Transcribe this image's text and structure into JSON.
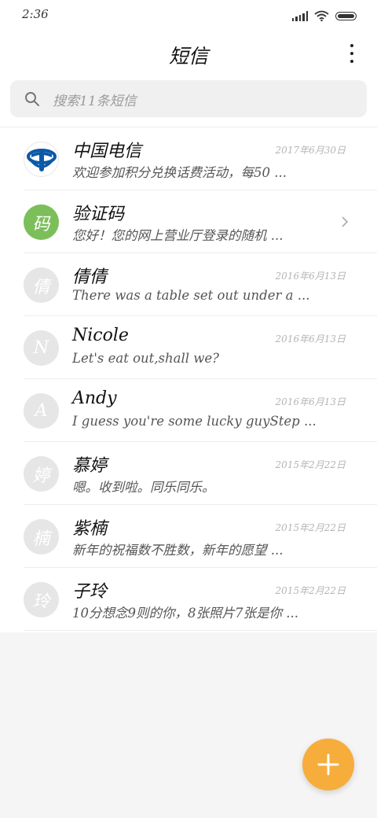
{
  "status_bar": {
    "time": "2:36"
  },
  "header": {
    "title": "短信"
  },
  "search": {
    "placeholder": "搜索11条短信"
  },
  "conversations": [
    {
      "name": "中国电信",
      "date": "2017年6月30日",
      "preview": "欢迎参加积分兑换话费活动，每50 ...",
      "avatar_text": "",
      "avatar_type": "logo",
      "has_chevron": false
    },
    {
      "name": "验证码",
      "date": "",
      "preview": "您好！您的网上营业厅登录的随机 ...",
      "avatar_text": "码",
      "avatar_type": "green",
      "has_chevron": true
    },
    {
      "name": "倩倩",
      "date": "2016年6月13日",
      "preview": "There was a table set out under a ...",
      "avatar_text": "倩",
      "avatar_type": "default",
      "has_chevron": false
    },
    {
      "name": "Nicole",
      "date": "2016年6月13日",
      "preview": "Let's eat out,shall we?",
      "avatar_text": "N",
      "avatar_type": "default",
      "has_chevron": false
    },
    {
      "name": "Andy",
      "date": "2016年6月13日",
      "preview": "I guess you're some lucky guyStep ...",
      "avatar_text": "A",
      "avatar_type": "default",
      "has_chevron": false
    },
    {
      "name": "慕婷",
      "date": "2015年2月22日",
      "preview": "嗯。收到啦。同乐同乐。",
      "avatar_text": "婷",
      "avatar_type": "default",
      "has_chevron": false
    },
    {
      "name": "紫楠",
      "date": "2015年2月22日",
      "preview": "新年的祝福数不胜数，新年的愿望 ...",
      "avatar_text": "楠",
      "avatar_type": "default",
      "has_chevron": false
    },
    {
      "name": "子玲",
      "date": "2015年2月22日",
      "preview": "10分想念9则的你，8张照片7张是你 ...",
      "avatar_text": "玲",
      "avatar_type": "default",
      "has_chevron": false
    }
  ],
  "colors": {
    "accent": "#f6ad3b",
    "avatar_green": "#7cbf5a",
    "avatar_default": "#e6e6e6",
    "telecom_blue": "#0b5aa8"
  },
  "icons": {
    "fab": "plus-icon",
    "search": "search-icon",
    "menu": "more-vertical-icon"
  }
}
